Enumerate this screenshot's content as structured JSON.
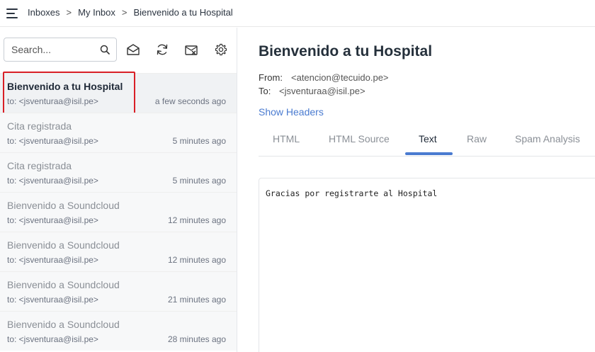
{
  "breadcrumb": {
    "items": [
      "Inboxes",
      "My Inbox",
      "Bienvenido a tu Hospital"
    ],
    "separator": ">"
  },
  "icons": {
    "menu": "hamburger-menu-icon",
    "search": "magnifier-icon",
    "mark_read": "envelope-open-icon",
    "refresh": "refresh-icon",
    "clear": "inbox-clear-icon",
    "settings": "gear-icon"
  },
  "search": {
    "placeholder": "Search..."
  },
  "messages": [
    {
      "subject": "Bienvenido a tu Hospital",
      "to": "to: <jsventuraa@isil.pe>",
      "time": "a few seconds ago",
      "active": true
    },
    {
      "subject": "Cita registrada",
      "to": "to: <jsventuraa@isil.pe>",
      "time": "5 minutes ago"
    },
    {
      "subject": "Cita registrada",
      "to": "to: <jsventuraa@isil.pe>",
      "time": "5 minutes ago"
    },
    {
      "subject": "Bienvenido a Soundcloud",
      "to": "to: <jsventuraa@isil.pe>",
      "time": "12 minutes ago"
    },
    {
      "subject": "Bienvenido a Soundcloud",
      "to": "to: <jsventuraa@isil.pe>",
      "time": "12 minutes ago"
    },
    {
      "subject": "Bienvenido a Soundcloud",
      "to": "to: <jsventuraa@isil.pe>",
      "time": "21 minutes ago"
    },
    {
      "subject": "Bienvenido a Soundcloud",
      "to": "to: <jsventuraa@isil.pe>",
      "time": "28 minutes ago"
    }
  ],
  "email": {
    "subject": "Bienvenido a tu Hospital",
    "from_label": "From:",
    "from": "<atencion@tecuido.pe>",
    "to_label": "To:",
    "to": "<jsventuraa@isil.pe>",
    "show_headers": "Show Headers",
    "tabs": [
      "HTML",
      "HTML Source",
      "Text",
      "Raw",
      "Spam Analysis"
    ],
    "active_tab": "Text",
    "body": "Gracias por registrarte al Hospital"
  },
  "colors": {
    "accent": "#4a7bd0",
    "highlight": "#d91f26"
  }
}
